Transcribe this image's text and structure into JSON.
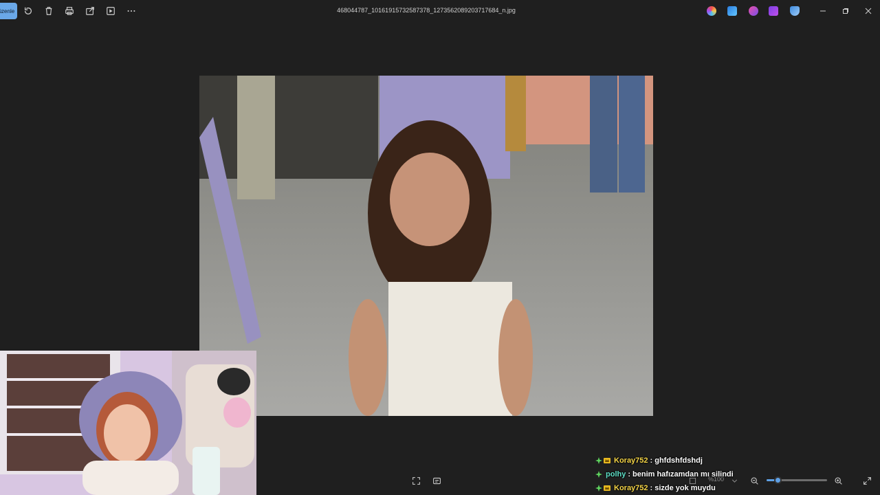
{
  "titlebar": {
    "edit_label": "Düzenle",
    "filename": "468044787_10161915732587378_1273562089203717684_n.jpg"
  },
  "toolbar": {
    "icons": [
      "rotate-icon",
      "delete-icon",
      "print-icon",
      "share-icon",
      "slideshow-icon",
      "more-icon"
    ]
  },
  "bottombar": {
    "zoom_level": "%100",
    "zoom_fraction": 0.18
  },
  "chat": {
    "messages": [
      {
        "user": "Koray752",
        "text": "ghfdshfdshdj",
        "user_color": "#f5d547"
      },
      {
        "user": "polhy",
        "text": "benim hafızamdan mı silindi",
        "user_color": "#5fe0c8"
      },
      {
        "user": "Koray752",
        "text": "sizde yok muydu",
        "user_color": "#f5d547"
      }
    ]
  },
  "colors": {
    "background": "#1f1f1f",
    "accent": "#5ea0e6"
  }
}
